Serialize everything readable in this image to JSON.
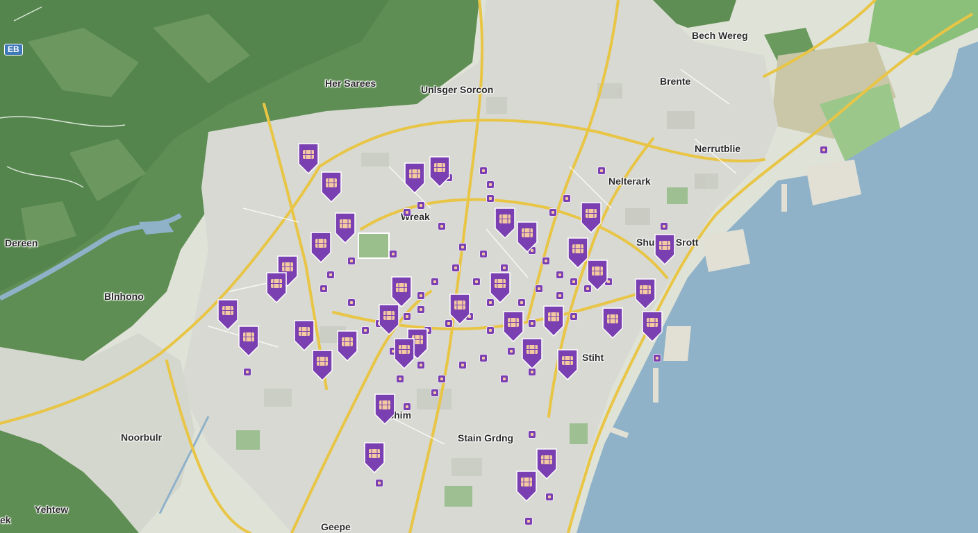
{
  "map": {
    "badge": "EB",
    "colors": {
      "water": "#8fb2c9",
      "forest": "#5f8f55",
      "urban": "#d6d9d0",
      "road_major": "#e9c545",
      "pin_fill": "#7a3fb0",
      "pin_icon": "#f2c9a0"
    },
    "pin_icon": "sim-card-icon",
    "labels": [
      {
        "id": "beach-wereg",
        "text": "Bech Wereg"
      },
      {
        "id": "her-sarees",
        "text": "Her Sarees"
      },
      {
        "id": "unlsger-sorcon",
        "text": "Unlsger Sorcon"
      },
      {
        "id": "brente",
        "text": "Brente"
      },
      {
        "id": "nerrutblie",
        "text": "Nerrutblie"
      },
      {
        "id": "nelterark",
        "text": "Nelterark"
      },
      {
        "id": "wreak",
        "text": "Wreak"
      },
      {
        "id": "dereen",
        "text": "Dereen"
      },
      {
        "id": "shurear-srott",
        "text": "Shurear Srott"
      },
      {
        "id": "blnhono",
        "text": "Blnhono"
      },
      {
        "id": "stiht",
        "text": "Stiht"
      },
      {
        "id": "vchim",
        "text": "Vchim"
      },
      {
        "id": "nooobulir",
        "text": "Noorbulr"
      },
      {
        "id": "stain-grdng",
        "text": "Stain Grdng"
      },
      {
        "id": "yehtew",
        "text": "Yehtew"
      },
      {
        "id": "ek",
        "text": "ek"
      },
      {
        "id": "geepe",
        "text": "Geepe"
      }
    ]
  }
}
